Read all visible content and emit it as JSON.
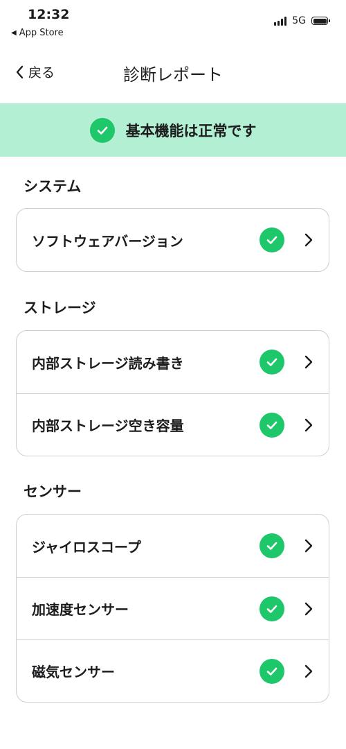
{
  "status_bar": {
    "time": "12:32",
    "back_app": "App Store",
    "network": "5G"
  },
  "nav": {
    "back_label": "戻る",
    "title": "診断レポート"
  },
  "banner": {
    "text": "基本機能は正常です"
  },
  "sections": [
    {
      "title": "システム",
      "items": [
        {
          "label": "ソフトウェアバージョン"
        }
      ]
    },
    {
      "title": "ストレージ",
      "items": [
        {
          "label": "内部ストレージ読み書き"
        },
        {
          "label": "内部ストレージ空き容量"
        }
      ]
    },
    {
      "title": "センサー",
      "items": [
        {
          "label": "ジャイロスコープ"
        },
        {
          "label": "加速度センサー"
        },
        {
          "label": "磁気センサー"
        }
      ]
    }
  ],
  "colors": {
    "banner_bg": "#b3f0d3",
    "check_green": "#1ec76a"
  }
}
